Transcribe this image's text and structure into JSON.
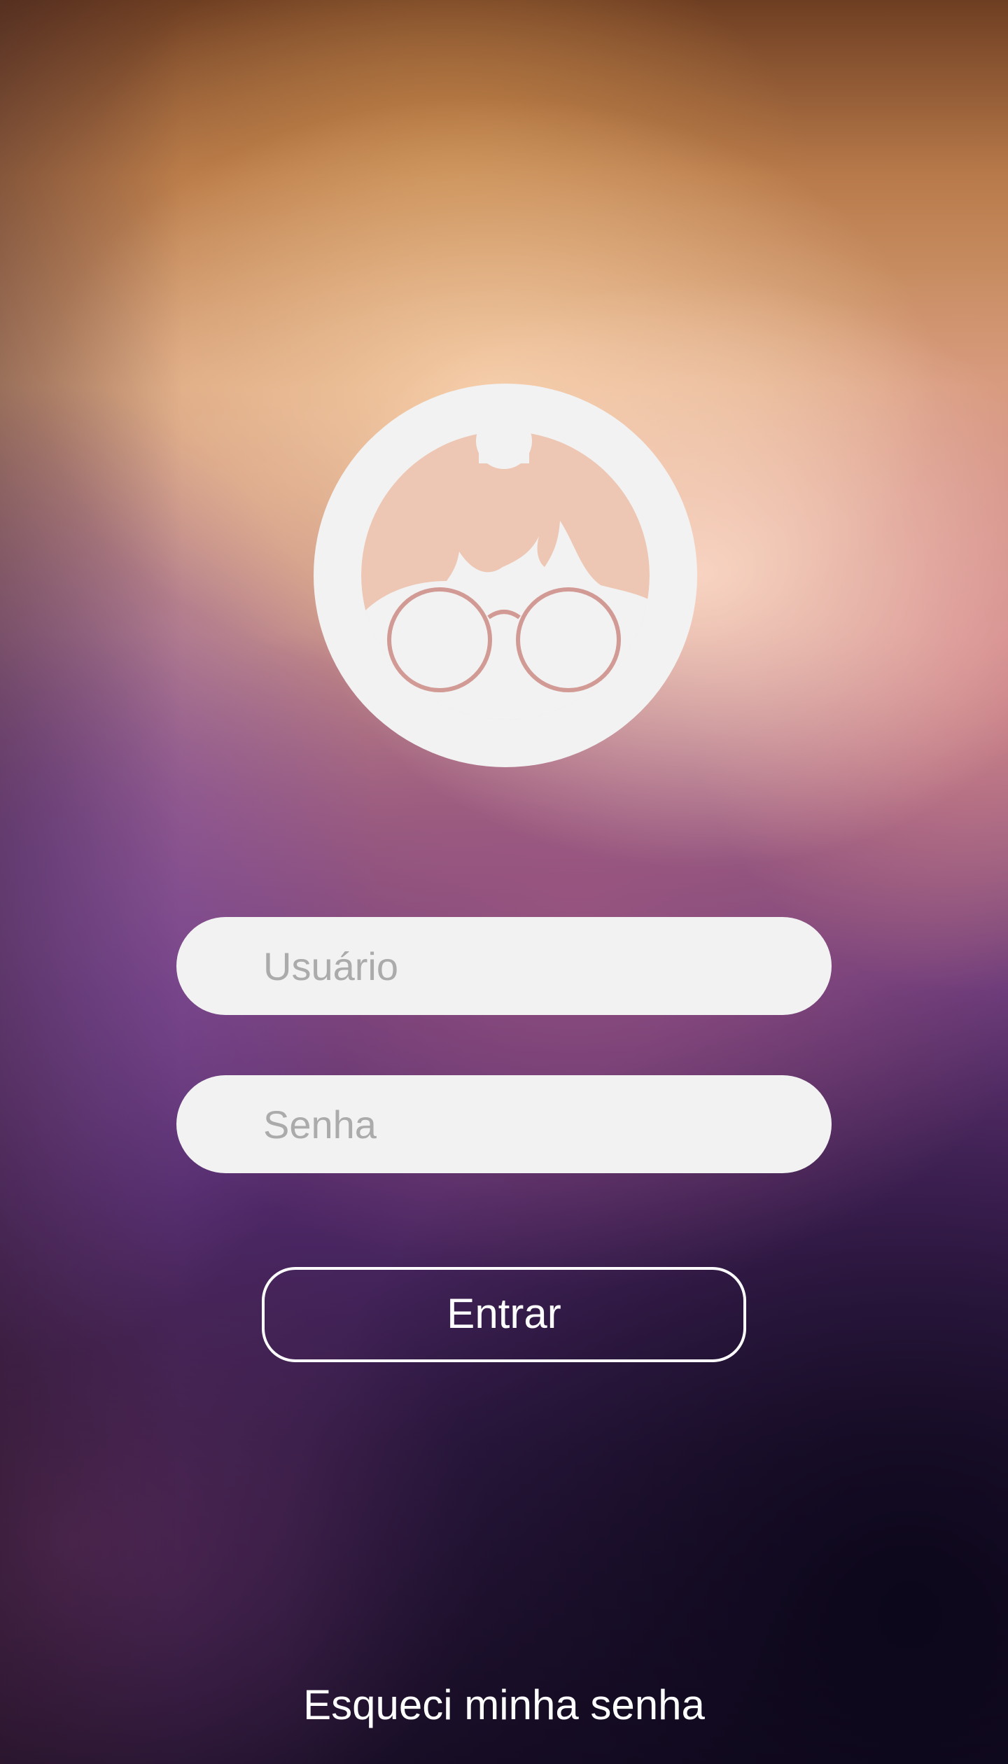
{
  "app": {
    "logo_icon": "grandma-glasses-icon",
    "colors": {
      "logo_fill": "#f2f2f2",
      "glasses": "#d29a94",
      "field_bg": "#f2f2f2",
      "placeholder": "#ababab",
      "button_border": "#ffffff"
    }
  },
  "login": {
    "username": {
      "placeholder": "Usuário",
      "value": ""
    },
    "password": {
      "placeholder": "Senha",
      "value": ""
    },
    "submit_label": "Entrar",
    "forgot_label": "Esqueci minha senha"
  }
}
